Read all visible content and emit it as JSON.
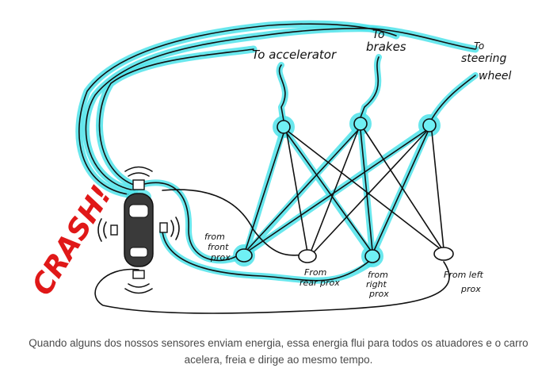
{
  "diagram": {
    "actuators": {
      "accelerator": "To accelerator",
      "brakes_to": "To",
      "brakes": "brakes",
      "steering_to": "To",
      "steering_1": "steering",
      "steering_2": "wheel"
    },
    "sensors": {
      "front_1": "from",
      "front_2": "front",
      "front_3": "prox",
      "rear_1": "From",
      "rear_2": "rear prox",
      "right_1": "from",
      "right_2": "right",
      "right_3": "prox",
      "left_1": "From left",
      "left_2": "prox"
    },
    "crash_label": "CRASH!",
    "colors": {
      "energy": "#4fe3ea",
      "crash": "#e01818",
      "ink": "#111111"
    }
  },
  "caption": "Quando alguns dos nossos sensores enviam energia, essa energia flui para todos os atuadores e o carro acelera, freia e dirige ao mesmo tempo."
}
